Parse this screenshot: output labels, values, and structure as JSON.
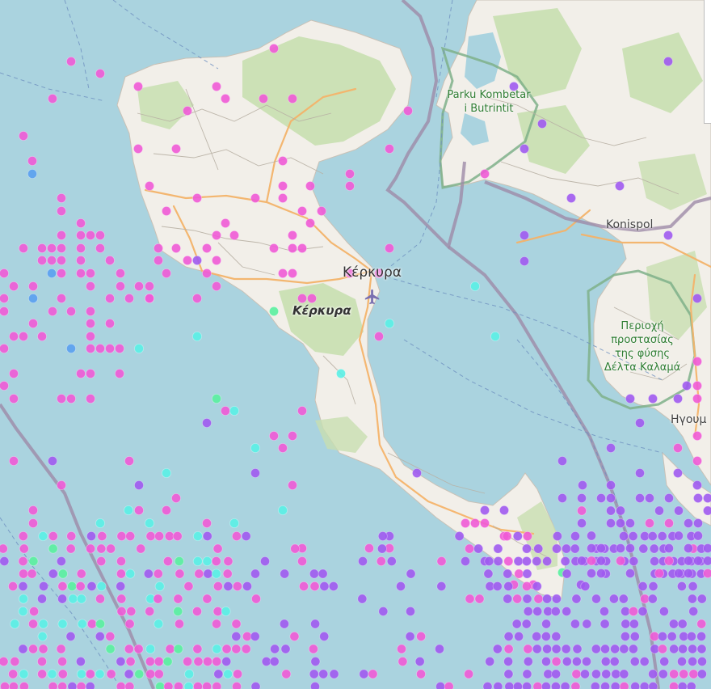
{
  "map": {
    "labels": {
      "corfu_city": "Κέρκυρα",
      "corfu_island": "Κέρκυρα",
      "konispol": "Konispol",
      "igoumenitsa": "Ηγουμ",
      "butrint_park_line1": "Parku Kombetar",
      "butrint_park_line2": "i Butrintit",
      "kalamas_line1": "Περιοχή",
      "kalamas_line2": "προστασίας",
      "kalamas_line3": "της φύσης",
      "kalamas_line4": "Δέλτα Καλαμά"
    },
    "icons": {
      "airport": "airport-icon"
    },
    "colors": {
      "sea": "#aad3df",
      "land": "#f2efe9",
      "forest": "#c8dfb0",
      "road": "#f4b36a",
      "border": "#9e8ba8",
      "park_outline": "#7fb08a",
      "marker_magenta": "#f05ad6",
      "marker_violet": "#a05af0",
      "marker_blue": "#5aa0f0",
      "marker_cyan": "#5af0e6",
      "marker_green": "#5af0a0"
    }
  }
}
